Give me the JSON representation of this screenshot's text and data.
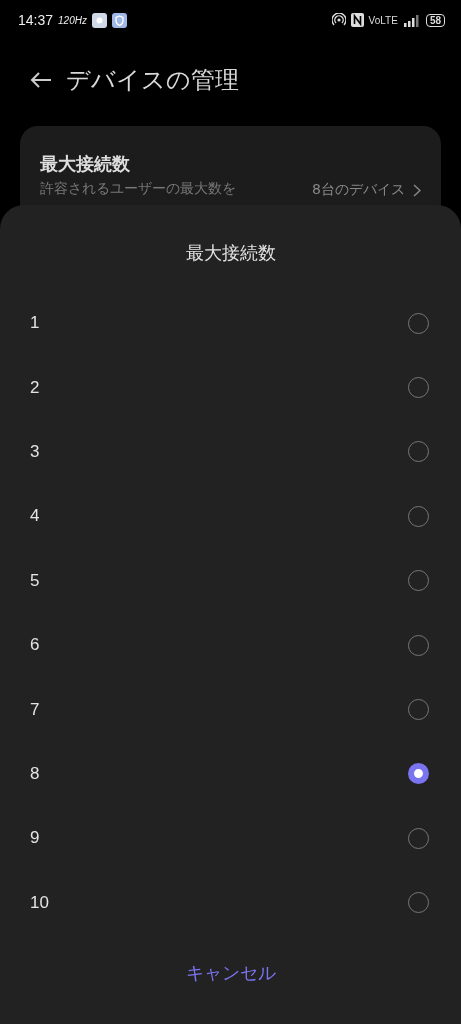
{
  "status_bar": {
    "time": "14:37",
    "refresh_rate": "120Hz",
    "network": "VoLTE",
    "battery": "58"
  },
  "header": {
    "title": "デバイスの管理"
  },
  "setting": {
    "title": "最大接続数",
    "subtitle": "許容されるユーザーの最大数を",
    "value": "8台のデバイス"
  },
  "sheet": {
    "title": "最大接続数",
    "options": [
      {
        "label": "1",
        "selected": false
      },
      {
        "label": "2",
        "selected": false
      },
      {
        "label": "3",
        "selected": false
      },
      {
        "label": "4",
        "selected": false
      },
      {
        "label": "5",
        "selected": false
      },
      {
        "label": "6",
        "selected": false
      },
      {
        "label": "7",
        "selected": false
      },
      {
        "label": "8",
        "selected": true
      },
      {
        "label": "9",
        "selected": false
      },
      {
        "label": "10",
        "selected": false
      }
    ],
    "cancel": "キャンセル"
  }
}
